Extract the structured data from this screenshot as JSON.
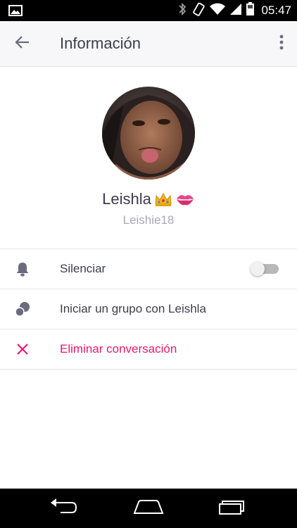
{
  "status_bar": {
    "time": "05:47",
    "icons": [
      "image-notification-icon",
      "bluetooth-icon",
      "vibrate-icon",
      "wifi-icon",
      "signal-icon",
      "battery-icon"
    ]
  },
  "app_bar": {
    "title": "Información",
    "back_icon": "arrow-back-icon",
    "menu_icon": "more-vert-icon"
  },
  "profile": {
    "name": "Leishla",
    "name_emojis": [
      "crown-emoji",
      "kiss-mark-emoji"
    ],
    "username": "Leishie18"
  },
  "items": [
    {
      "label": "Silenciar",
      "icon": "bell-icon",
      "toggle_on": false
    },
    {
      "label": "Iniciar un grupo con Leishla",
      "icon": "group-icon"
    },
    {
      "label": "Eliminar conversación",
      "icon": "close-icon"
    }
  ],
  "colors": {
    "accent_danger": "#e8196f",
    "text_primary": "#3d3c4c",
    "text_secondary": "#a9a7ba",
    "icon_color": "#6b6a7e"
  },
  "nav_bar": {
    "icons": [
      "back-nav-icon",
      "home-nav-icon",
      "recents-nav-icon"
    ]
  }
}
